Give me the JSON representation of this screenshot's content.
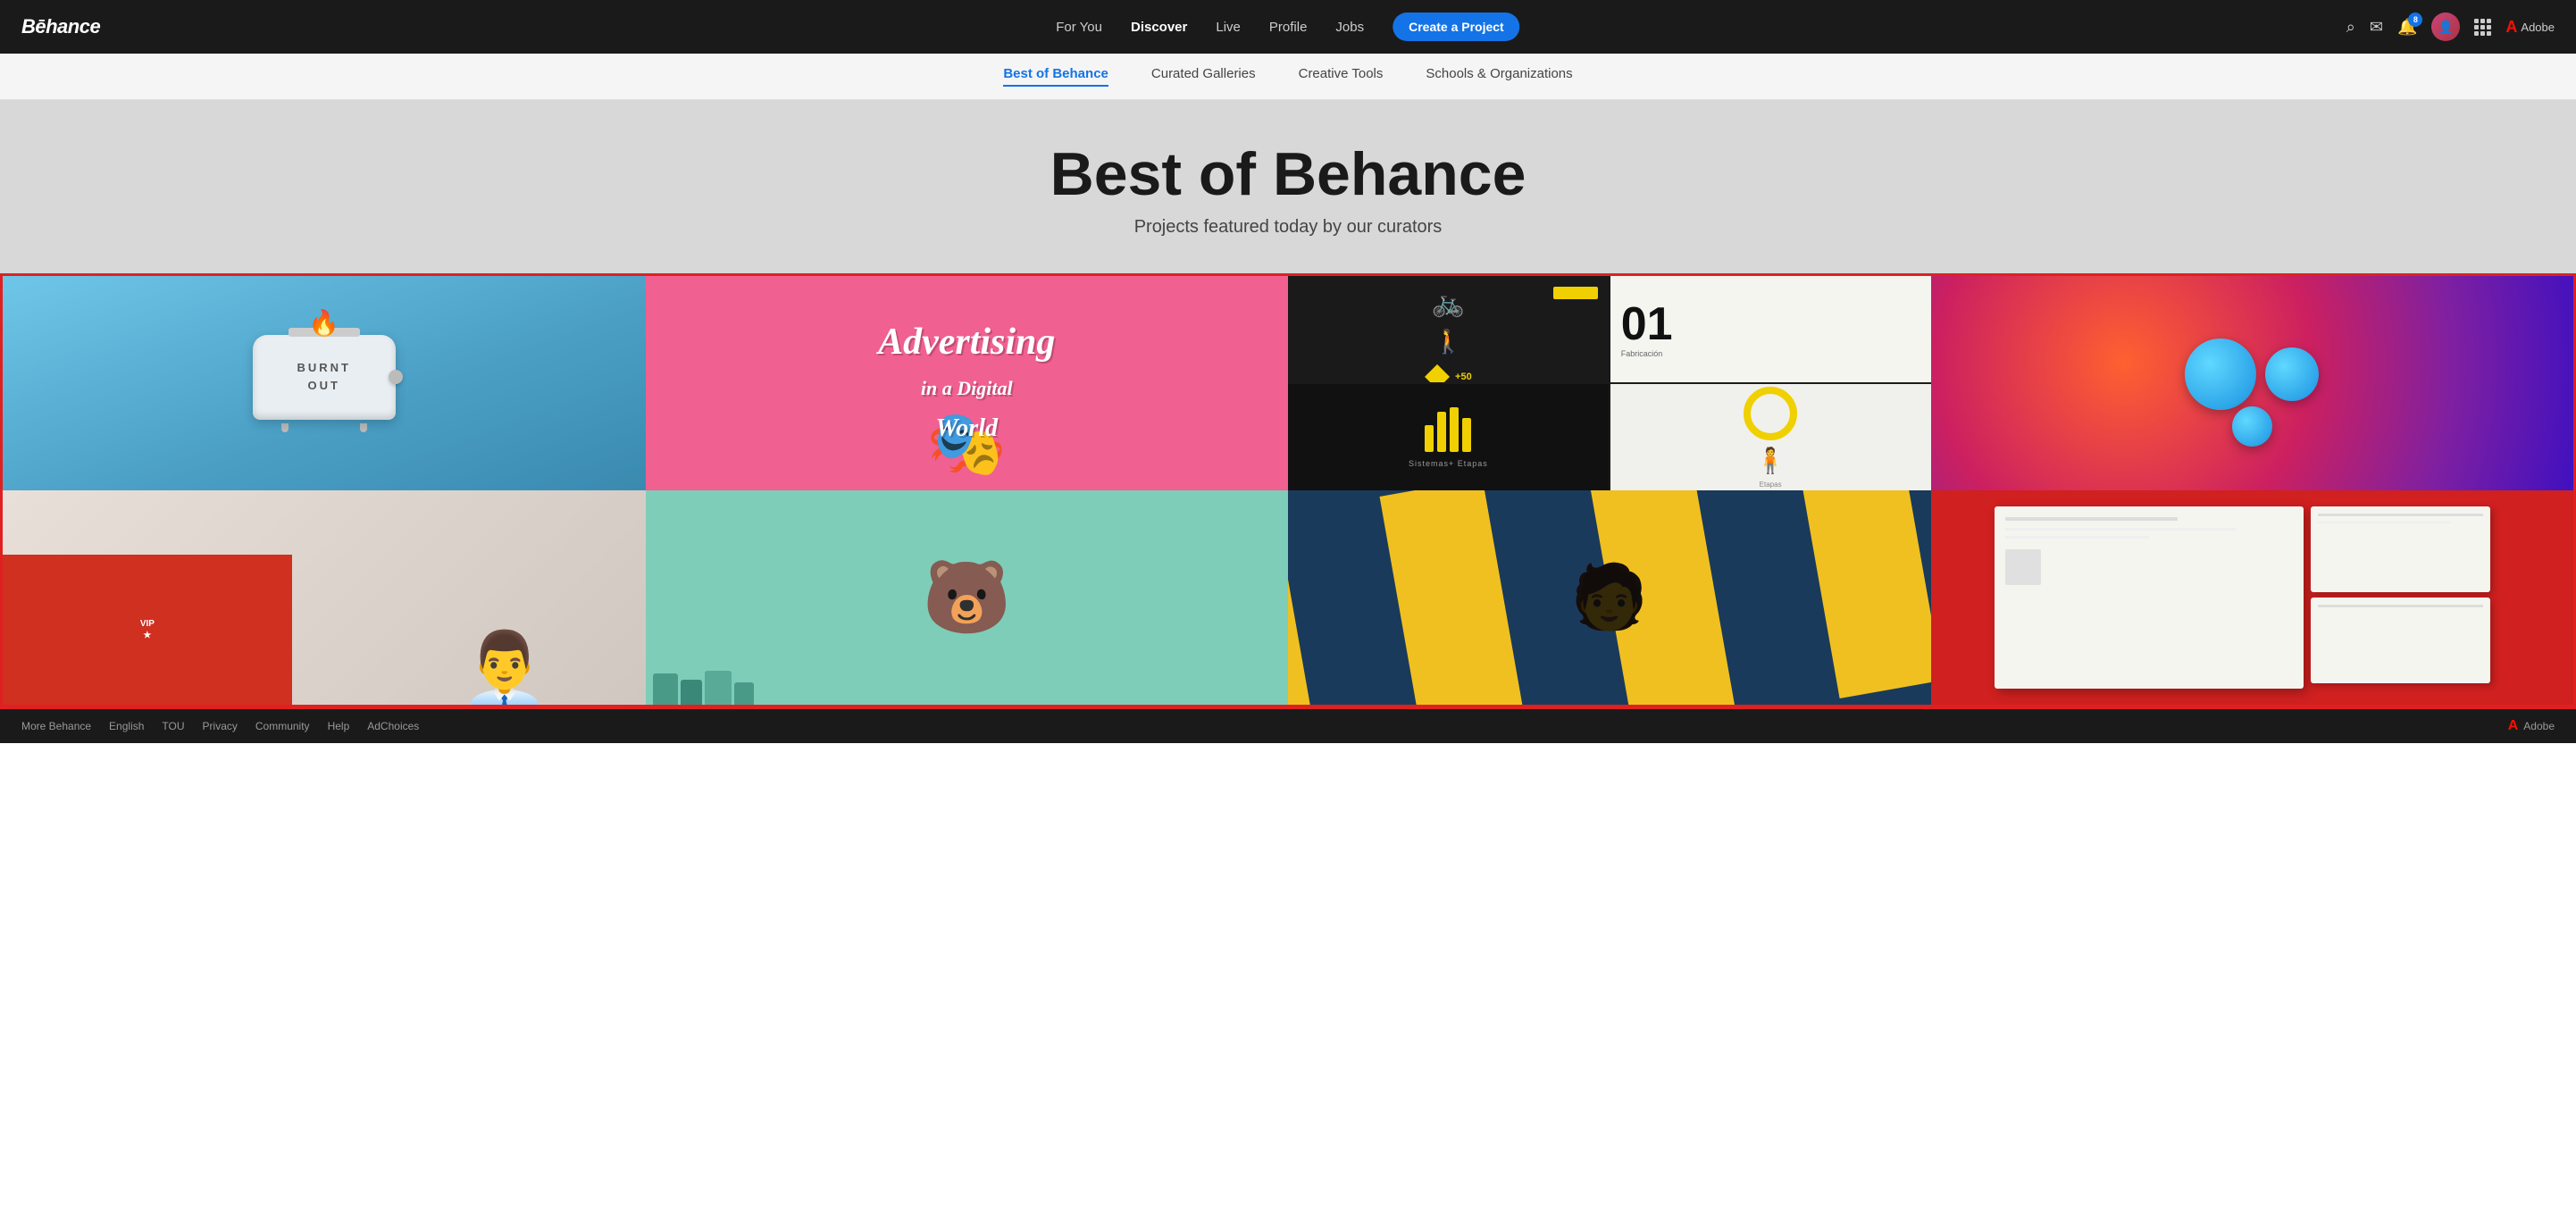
{
  "brand": {
    "name": "Bēhance"
  },
  "navbar": {
    "links": [
      {
        "label": "For You",
        "active": false
      },
      {
        "label": "Discover",
        "active": true
      },
      {
        "label": "Live",
        "active": false
      },
      {
        "label": "Profile",
        "active": false
      },
      {
        "label": "Jobs",
        "active": false
      }
    ],
    "cta_label": "Create a Project",
    "notification_count": "8",
    "adobe_label": "Adobe"
  },
  "secondary_nav": {
    "links": [
      {
        "label": "Best of Behance",
        "active": true
      },
      {
        "label": "Curated Galleries",
        "active": false
      },
      {
        "label": "Creative Tools",
        "active": false
      },
      {
        "label": "Schools & Organizations",
        "active": false
      }
    ]
  },
  "hero": {
    "title": "Best of Behance",
    "subtitle": "Projects featured today by our curators"
  },
  "gallery": {
    "row1": [
      {
        "id": "card-1",
        "type": "toaster",
        "alt": "Burnt Out Toaster"
      },
      {
        "id": "card-2",
        "type": "advertising",
        "alt": "Advertising in a Digital World"
      },
      {
        "id": "card-3",
        "type": "design-system",
        "alt": "Design System"
      },
      {
        "id": "card-4",
        "type": "colorful-balls",
        "alt": "Colorful Balls on Red Background"
      }
    ],
    "row2": [
      {
        "id": "card-5",
        "type": "person-red-box",
        "alt": "Person with Red Box"
      },
      {
        "id": "card-6",
        "type": "cartoon-character",
        "alt": "Cartoon Character Houses"
      },
      {
        "id": "card-7",
        "type": "yellow-stripes",
        "alt": "Yellow Stripes Person"
      },
      {
        "id": "card-8",
        "type": "red-design",
        "alt": "Red Design Paper"
      }
    ]
  },
  "footer": {
    "more_behance": "More Behance",
    "language": "English",
    "links": [
      "TOU",
      "Privacy",
      "Community",
      "Help"
    ],
    "adchoices": "AdChoices",
    "adobe_label": "Adobe"
  }
}
